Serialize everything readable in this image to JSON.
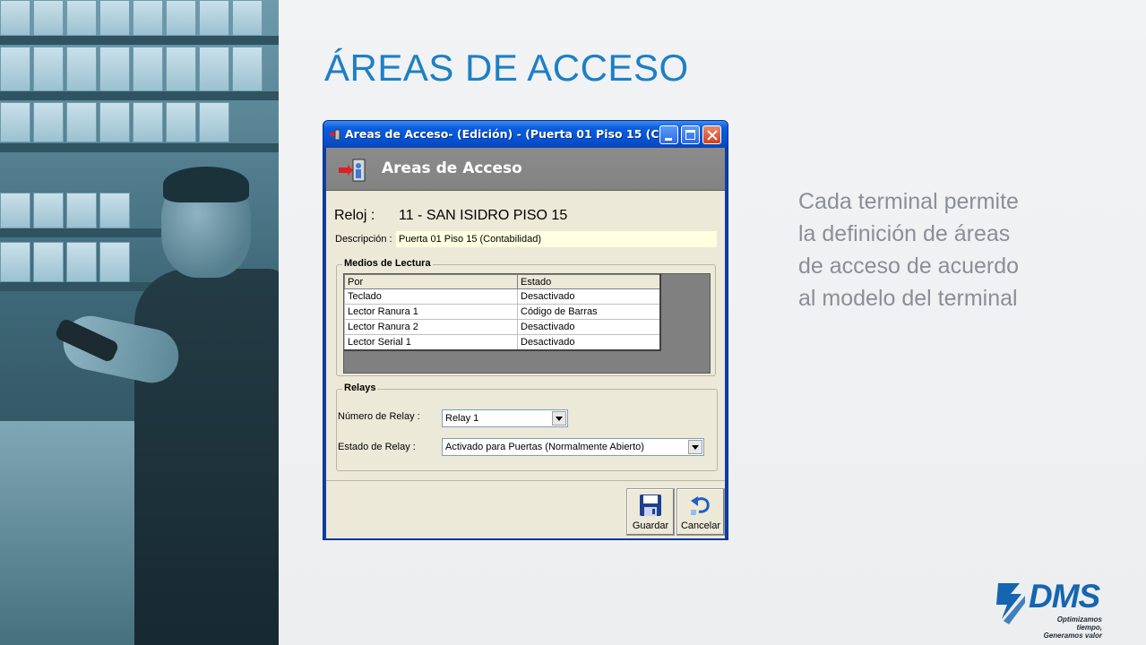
{
  "slide": {
    "title": "ÁREAS DE ACCESO",
    "description_lines": [
      "Cada terminal permite",
      "la definición de áreas",
      "de acceso de acuerdo",
      "al modelo del terminal"
    ]
  },
  "logo": {
    "name": "DMS",
    "tagline_1": "Optimizamos tiempo,",
    "tagline_2": "Generamos valor",
    "color": "#1565b0"
  },
  "window": {
    "title": "Areas de Acceso- (Edición) - (Puerta 01 Piso 15 (C...",
    "header_title": "Areas de Acceso",
    "reloj_label": "Reloj :",
    "reloj_value": "11 - SAN ISIDRO PISO 15",
    "descripcion_label": "Descripción :",
    "descripcion_value": "Puerta 01 Piso 15 (Contabilidad)",
    "medios": {
      "legend": "Medios de Lectura",
      "columns": [
        "Por",
        "Estado"
      ],
      "rows": [
        [
          "Teclado",
          "Desactivado"
        ],
        [
          "Lector Ranura 1",
          "Código de Barras"
        ],
        [
          "Lector Ranura 2",
          "Desactivado"
        ],
        [
          "Lector Serial 1",
          "Desactivado"
        ]
      ]
    },
    "relays": {
      "legend": "Relays",
      "numero_label": "Número de Relay :",
      "numero_value": "Relay 1",
      "estado_label": "Estado de Relay :",
      "estado_value": "Activado para Puertas (Normalmente Abierto)"
    },
    "buttons": {
      "guardar": "Guardar",
      "cancelar": "Cancelar"
    }
  },
  "colors": {
    "title_blue": "#1e7fc4",
    "xp_title_blue": "#0553d2",
    "window_face": "#ece9d8"
  }
}
